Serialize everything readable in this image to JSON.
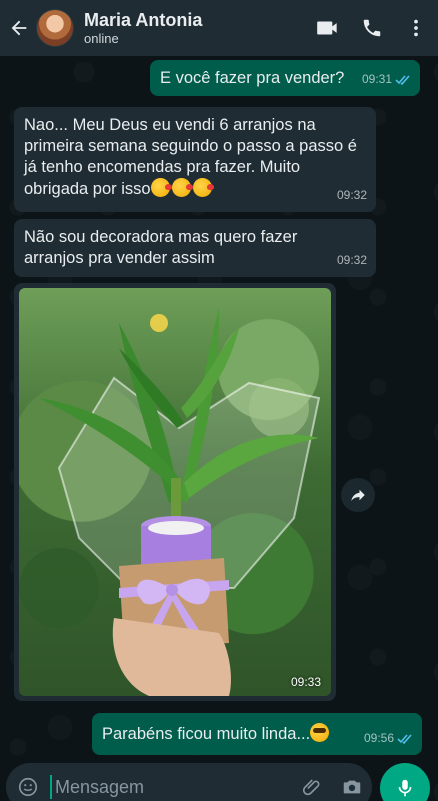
{
  "header": {
    "contact_name": "Maria Antonia",
    "status": "online",
    "icons": [
      "back-arrow-icon",
      "video-call-icon",
      "phone-icon",
      "more-vert-icon"
    ]
  },
  "messages": [
    {
      "direction": "out",
      "text": "E você fazer pra vender?",
      "time": "09:31",
      "read": true
    },
    {
      "direction": "in",
      "text": "Nao... Meu Deus eu vendi 6 arranjos na primeira semana seguindo o passo a passo é já tenho encomendas pra fazer. Muito obrigada por isso",
      "emojis": [
        "kissing-face",
        "kissing-face",
        "kissing-face"
      ],
      "time": "09:32"
    },
    {
      "direction": "in",
      "text": "Não sou decoradora mas quero fazer arranjos pra vender assim",
      "time": "09:32"
    },
    {
      "direction": "in",
      "type": "image",
      "image_desc": "lucky bamboo arrangement in purple pot",
      "time": "09:33"
    },
    {
      "direction": "out",
      "text": "Parabéns ficou muito linda...",
      "emojis": [
        "star-struck"
      ],
      "time": "09:56",
      "read": true
    }
  ],
  "input": {
    "placeholder": "Mensagem"
  },
  "colors": {
    "header_bg": "#1f2c33",
    "outgoing_bubble": "#005c4b",
    "incoming_bubble": "#1f2c33",
    "accent": "#00a884",
    "read_tick": "#53bdeb"
  }
}
